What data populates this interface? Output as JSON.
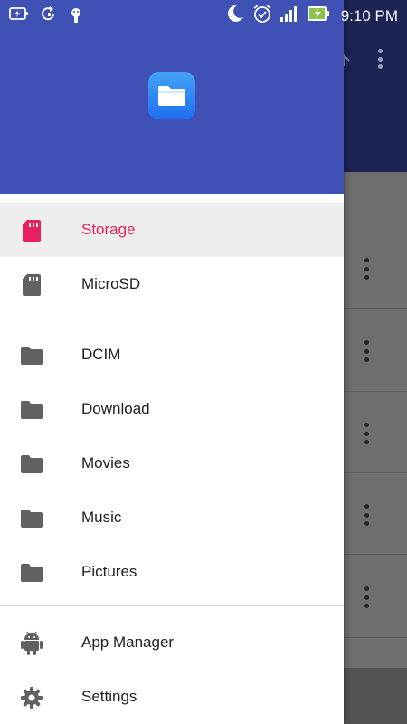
{
  "status_bar": {
    "time": "9:10 PM",
    "left_icons": [
      "battery-saver-icon",
      "sync-icon",
      "android-debug-icon"
    ],
    "right_icons": [
      "do-not-disturb-moon-icon",
      "alarm-icon",
      "signal-icon",
      "battery-charging-icon"
    ]
  },
  "drawer": {
    "header_color": "#3f51b5",
    "logo_icon": "folder-icon",
    "storage_items": [
      {
        "label": "Storage",
        "icon": "sd-card-icon",
        "active": true
      },
      {
        "label": "MicroSD",
        "icon": "sd-card-icon",
        "active": false
      }
    ],
    "folder_items": [
      {
        "label": "DCIM",
        "icon": "folder-icon"
      },
      {
        "label": "Download",
        "icon": "folder-icon"
      },
      {
        "label": "Movies",
        "icon": "folder-icon"
      },
      {
        "label": "Music",
        "icon": "folder-icon"
      },
      {
        "label": "Pictures",
        "icon": "folder-icon"
      }
    ],
    "tool_items": [
      {
        "label": "App Manager",
        "icon": "android-icon"
      },
      {
        "label": "Settings",
        "icon": "gear-icon"
      }
    ]
  },
  "background_app": {
    "toolbar_icons": [
      "upload-icon",
      "overflow-menu-icon"
    ],
    "row_menu_icon": "overflow-menu-icon"
  },
  "colors": {
    "accent": "#e91e63",
    "primary": "#3f51b5",
    "icon_gray": "#616161"
  }
}
